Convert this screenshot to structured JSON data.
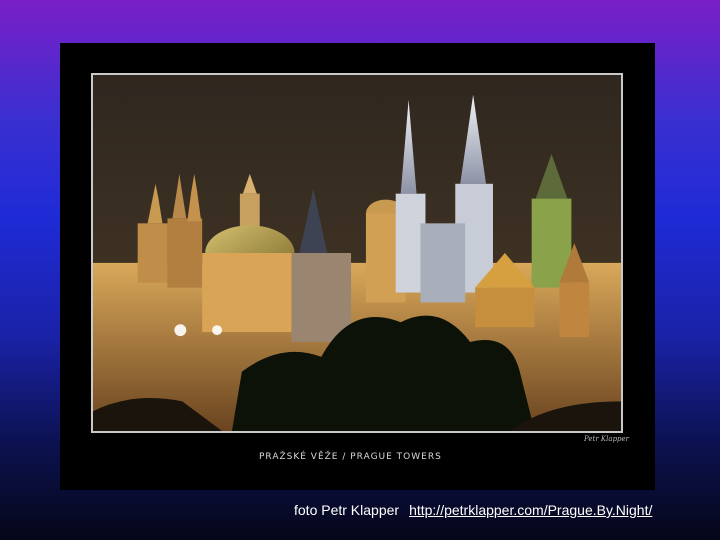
{
  "slide": {
    "caption": "PRAŽSKÉ VĚŽE / PRAGUE TOWERS",
    "signature": "Petr Klapper",
    "credit_text": "foto Petr Klapper",
    "credit_link": "http://petrklapper.com/Prague.By.Night/"
  },
  "photo": {
    "subject": "Prague towers at night",
    "colors": {
      "sky": "#2b241c",
      "lit_stone": "#e0b66a",
      "dome": "#b59a3c",
      "tower_light": "#d8dde6",
      "trees": "#0d1208"
    }
  }
}
